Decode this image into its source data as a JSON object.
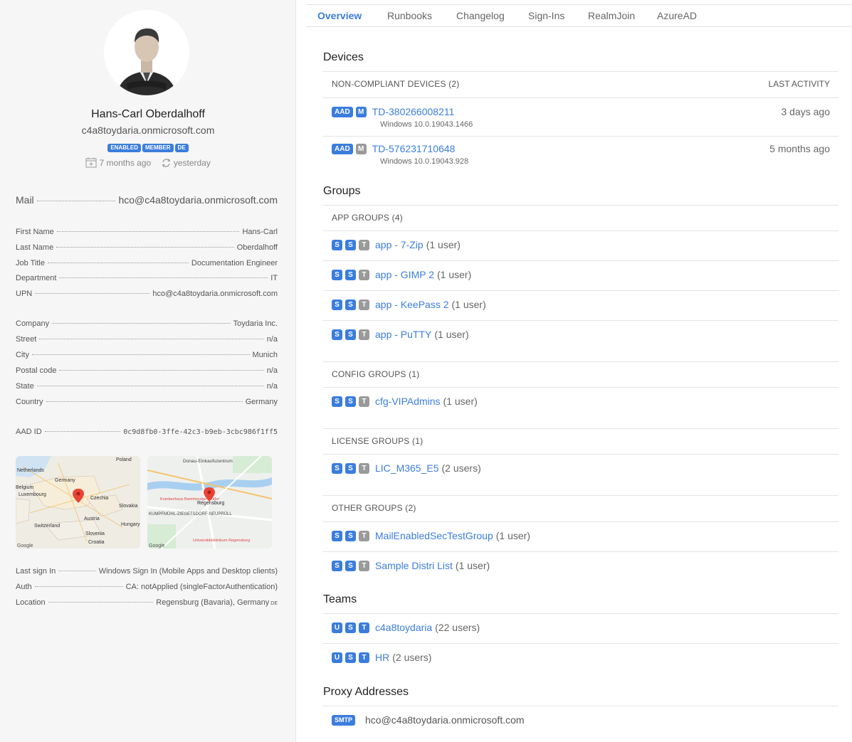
{
  "profile": {
    "name": "Hans-Carl Oberdalhoff",
    "upn": "c4a8toydaria.onmicrosoft.com",
    "badges": [
      "ENABLED",
      "MEMBER",
      "DE"
    ],
    "created": "7 months ago",
    "synced": "yesterday"
  },
  "mail": {
    "label": "Mail",
    "value": "hco@c4a8toydaria.onmicrosoft.com"
  },
  "identity": [
    {
      "label": "First Name",
      "value": "Hans-Carl"
    },
    {
      "label": "Last Name",
      "value": "Oberdalhoff"
    },
    {
      "label": "Job Title",
      "value": "Documentation Engineer"
    },
    {
      "label": "Department",
      "value": "IT"
    },
    {
      "label": "UPN",
      "value": "hco@c4a8toydaria.onmicrosoft.com"
    }
  ],
  "address": [
    {
      "label": "Company",
      "value": "Toydaria Inc."
    },
    {
      "label": "Street",
      "value": "n/a"
    },
    {
      "label": "City",
      "value": "Munich"
    },
    {
      "label": "Postal code",
      "value": "n/a"
    },
    {
      "label": "State",
      "value": "n/a"
    },
    {
      "label": "Country",
      "value": "Germany"
    }
  ],
  "aad": {
    "label": "AAD ID",
    "value": "0c9d8fb0-3ffe-42c3-b9eb-3cbc986f1ff5"
  },
  "maps": {
    "map1": [
      "Poland",
      "Netherlands",
      "Germany",
      "Belgium",
      "Luxembourg",
      "Czechia",
      "Slovakia",
      "Austria",
      "Switzerland",
      "Slovenia",
      "Hungary",
      "Croatia"
    ],
    "map2": [
      "Donau-Einkaufszentrum",
      "Regensburg",
      "KUMPFMÜHL-ZIEGETSDORF-NEUPRÜLL",
      "Krankenhaus Barmherzige Brüder",
      "Universitätsklinikum Regensburg"
    ],
    "google": "Google"
  },
  "signin": [
    {
      "label": "Last sign In",
      "value": "Windows Sign In (Mobile Apps and Desktop clients)"
    },
    {
      "label": "Auth",
      "value": "CA: notApplied (singleFactorAuthentication)"
    },
    {
      "label": "Location",
      "value": "Regensburg (Bavaria), Germany",
      "suffix": "DE"
    }
  ],
  "tabs": [
    "Overview",
    "Runbooks",
    "Changelog",
    "Sign-Ins",
    "RealmJoin",
    "AzureAD"
  ],
  "devices": {
    "title": "Devices",
    "header": "NON-COMPLIANT DEVICES (2)",
    "last_activity": "LAST ACTIVITY",
    "items": [
      {
        "name": "TD-380266008211",
        "os": "Windows 10.0.19043.1466",
        "when": "3 days ago",
        "tag1": "AAD",
        "tag2": "M"
      },
      {
        "name": "TD-576231710648",
        "os": "Windows 10.0.19043.928",
        "when": "5 months ago",
        "tag1": "AAD",
        "tag2": "M"
      }
    ]
  },
  "groups": {
    "title": "Groups",
    "app_header": "APP GROUPS (4)",
    "app": [
      {
        "name": "app - 7-Zip",
        "count": "(1 user)"
      },
      {
        "name": "app - GIMP 2",
        "count": "(1 user)"
      },
      {
        "name": "app - KeePass 2",
        "count": "(1 user)"
      },
      {
        "name": "app - PuTTY",
        "count": "(1 user)"
      }
    ],
    "config_header": "CONFIG GROUPS (1)",
    "config": [
      {
        "name": "cfg-VIPAdmins",
        "count": "(1 user)"
      }
    ],
    "license_header": "LICENSE GROUPS (1)",
    "license": [
      {
        "name": "LIC_M365_E5",
        "count": "(2 users)"
      }
    ],
    "other_header": "OTHER GROUPS (2)",
    "other": [
      {
        "name": "MailEnabledSecTestGroup",
        "count": "(1 user)"
      },
      {
        "name": "Sample Distri List",
        "count": "(1 user)"
      }
    ],
    "tags": [
      "S",
      "S",
      "T"
    ]
  },
  "teams": {
    "title": "Teams",
    "items": [
      {
        "name": "c4a8toydaria",
        "count": "(22 users)"
      },
      {
        "name": "HR",
        "count": "(2 users)"
      }
    ],
    "tags": [
      "U",
      "S",
      "T"
    ]
  },
  "proxy": {
    "title": "Proxy Addresses",
    "tag": "SMTP",
    "address": "hco@c4a8toydaria.onmicrosoft.com"
  },
  "colors": {
    "accent": "#3b7ddd",
    "tag_gray": "#9a9a9a",
    "left_bg": "#f6f6f6"
  }
}
